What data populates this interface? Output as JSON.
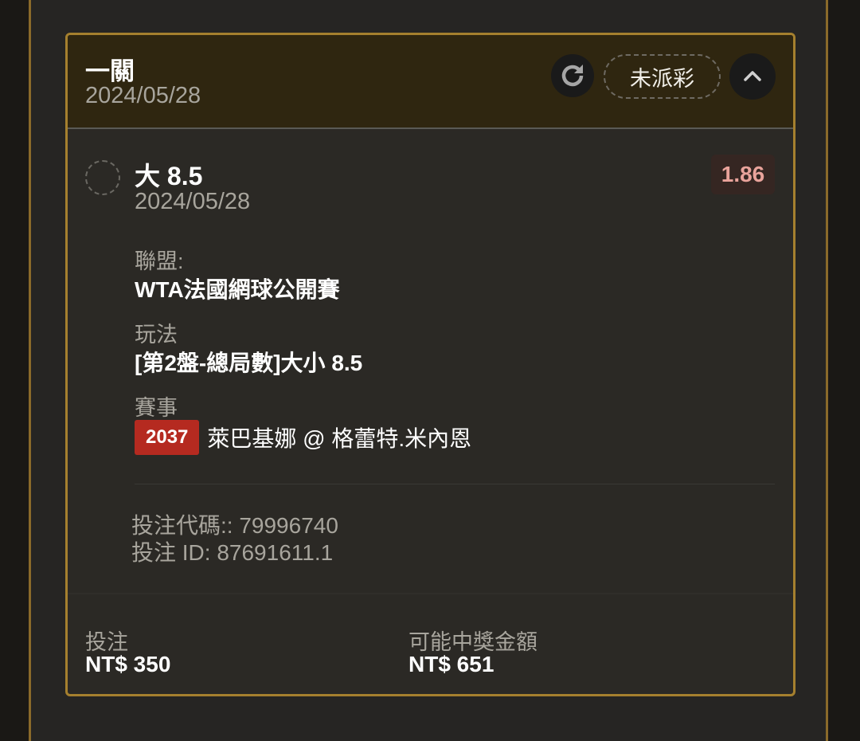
{
  "header": {
    "title": "一關",
    "date": "2024/05/28",
    "status": "未派彩"
  },
  "selection": {
    "name": "大 8.5",
    "date": "2024/05/28",
    "odds": "1.86"
  },
  "details": {
    "league_label": "聯盟:",
    "league_value": "WTA法國網球公開賽",
    "market_label": "玩法",
    "market_value": "[第2盤-總局數]大小 8.5",
    "event_label": "賽事",
    "event_id": "2037",
    "event_name": "萊巴基娜 @ 格蕾特.米內恩"
  },
  "meta": {
    "bet_code": "投注代碼:: 79996740",
    "bet_id": "投注 ID: 87691611.1"
  },
  "footer": {
    "stake_label": "投注",
    "stake_value": "NT$ 350",
    "payout_label": "可能中獎金額",
    "payout_value": "NT$ 651"
  },
  "colors": {
    "accent_border": "#a5802e",
    "odds_text": "#e9a39b",
    "event_badge": "#b52a20"
  },
  "icons": {
    "refresh": "refresh-icon",
    "collapse": "chevron-up-icon"
  }
}
